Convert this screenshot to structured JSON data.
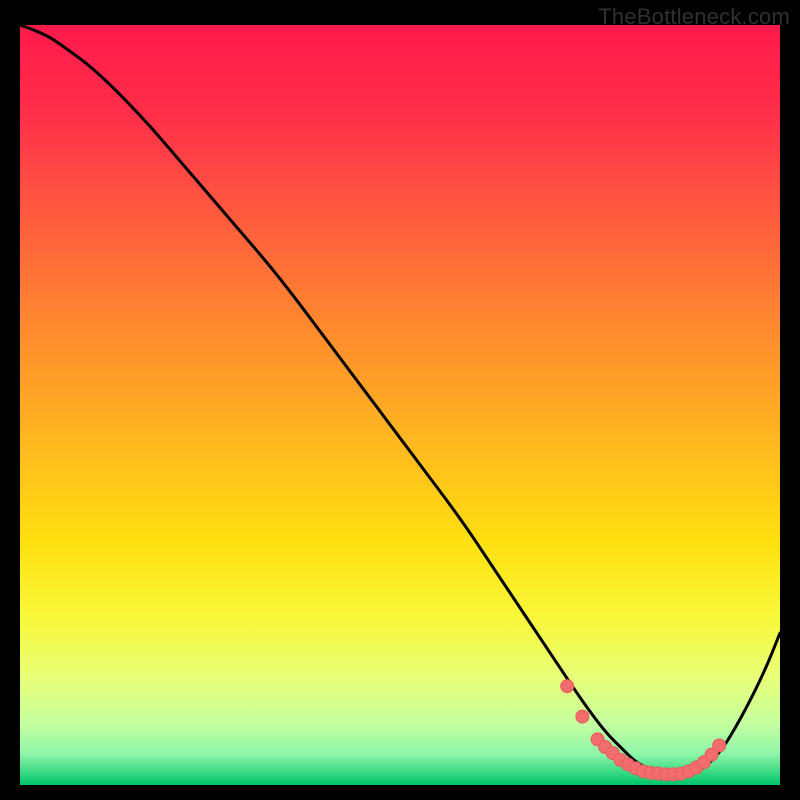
{
  "attribution": "TheBottleneck.com",
  "colors": {
    "gradient_stops": [
      {
        "offset": 0.0,
        "color": "#ff1a4b"
      },
      {
        "offset": 0.12,
        "color": "#ff2f4a"
      },
      {
        "offset": 0.25,
        "color": "#ff5a3f"
      },
      {
        "offset": 0.4,
        "color": "#ff8a2e"
      },
      {
        "offset": 0.55,
        "color": "#ffb81f"
      },
      {
        "offset": 0.68,
        "color": "#ffe010"
      },
      {
        "offset": 0.78,
        "color": "#f8f83a"
      },
      {
        "offset": 0.86,
        "color": "#e8ff78"
      },
      {
        "offset": 0.92,
        "color": "#c4ffa0"
      },
      {
        "offset": 0.96,
        "color": "#8cf5a8"
      },
      {
        "offset": 1.0,
        "color": "#00c56a"
      }
    ],
    "curve": "#000000",
    "marker_fill": "#f26e6e",
    "marker_stroke": "#e85a5a"
  },
  "chart_data": {
    "type": "line",
    "title": "",
    "xlabel": "",
    "ylabel": "",
    "xlim": [
      0,
      100
    ],
    "ylim": [
      0,
      100
    ],
    "series": [
      {
        "name": "bottleneck-curve",
        "x": [
          0,
          3,
          6,
          10,
          16,
          22,
          28,
          34,
          40,
          46,
          52,
          58,
          62,
          66,
          70,
          74,
          77,
          79,
          81,
          83,
          85,
          87,
          89,
          92,
          95,
          98,
          100
        ],
        "y": [
          100,
          99,
          97,
          94,
          88,
          81,
          74,
          67,
          59,
          51,
          43,
          35,
          29,
          23,
          17,
          11,
          7,
          5,
          3,
          2,
          1.5,
          1.3,
          1.5,
          4,
          9,
          15,
          20
        ]
      }
    ],
    "markers": {
      "name": "bottleneck-valley-markers",
      "x": [
        72,
        74,
        76,
        77,
        78,
        79,
        80,
        81,
        82,
        83,
        84,
        85,
        86,
        87,
        88,
        89,
        90,
        91,
        92
      ],
      "y": [
        13,
        9,
        6,
        5,
        4.2,
        3.3,
        2.7,
        2.2,
        1.8,
        1.6,
        1.5,
        1.4,
        1.4,
        1.5,
        1.8,
        2.3,
        3.0,
        4.0,
        5.2
      ]
    }
  }
}
